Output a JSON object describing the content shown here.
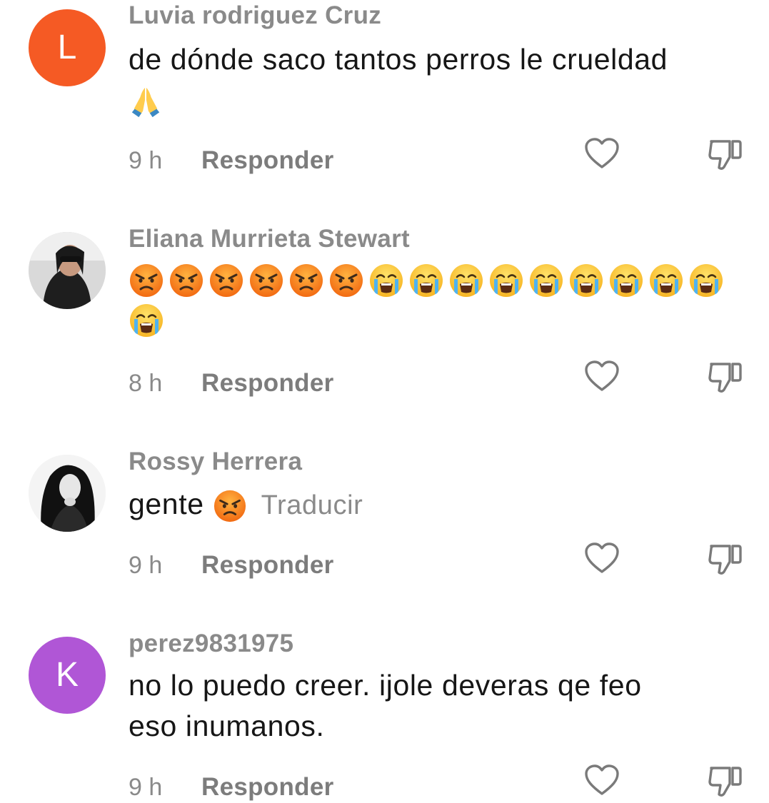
{
  "comments": [
    {
      "username": "Luvia rodriguez Cruz",
      "avatar": {
        "type": "letter",
        "letter": "L",
        "color": "#f55a24"
      },
      "text": "de dónde saco tantos perros le crueldad",
      "emojis": [
        "folded-hands"
      ],
      "time": "9 h",
      "reply_label": "Responder"
    },
    {
      "username": "Eliana Murrieta Stewart",
      "avatar": {
        "type": "photo"
      },
      "emojis": [
        "angry",
        "angry",
        "angry",
        "angry",
        "angry",
        "angry",
        "crying",
        "crying",
        "crying",
        "crying",
        "crying",
        "crying",
        "crying",
        "crying",
        "crying",
        "crying"
      ],
      "time": "8 h",
      "reply_label": "Responder"
    },
    {
      "username": "Rossy Herrera",
      "avatar": {
        "type": "photo"
      },
      "text": "gente",
      "emojis": [
        "angry"
      ],
      "translate_label": "Traducir",
      "time": "9 h",
      "reply_label": "Responder"
    },
    {
      "username": "perez9831975",
      "avatar": {
        "type": "letter",
        "letter": "K",
        "color": "#b056d6"
      },
      "text_line1": "no lo puedo creer. ijole deveras qe feo",
      "text_line2": "eso inumanos.",
      "time": "9 h",
      "reply_label": "Responder"
    }
  ],
  "colors": {
    "secondary_text": "#8a8a8a",
    "primary_text": "#161616"
  },
  "icons": {
    "like": "heart-outline-icon",
    "dislike": "thumbs-down-outline-icon"
  }
}
